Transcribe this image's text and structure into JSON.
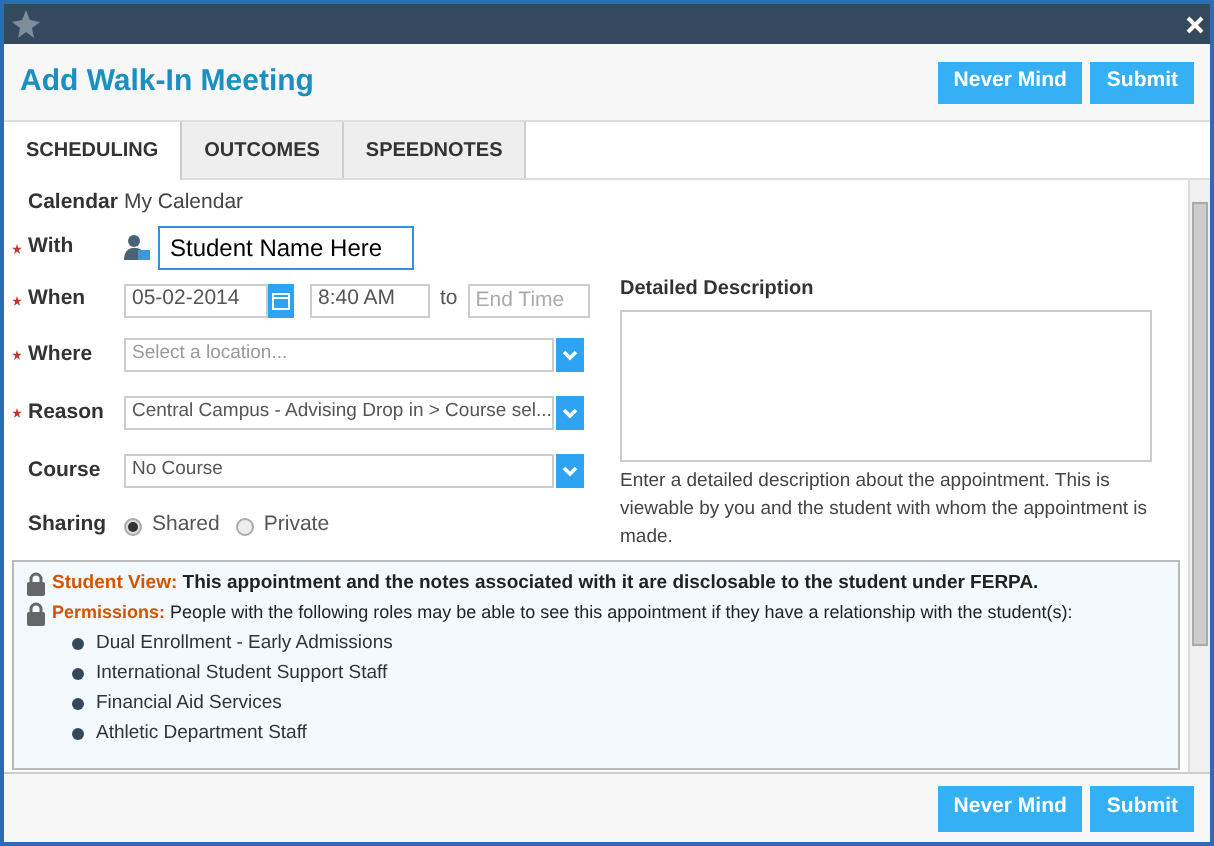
{
  "dialog": {
    "title": "Add Walk-In Meeting"
  },
  "header_buttons": [
    "Never Mind",
    "Submit"
  ],
  "tabs": [
    {
      "label": "SCHEDULING",
      "selected": true
    },
    {
      "label": "OUTCOMES",
      "selected": false
    },
    {
      "label": "SPEEDNOTES",
      "selected": false
    }
  ],
  "form": {
    "calendar": {
      "label": "Calendar",
      "value": "My Calendar"
    },
    "with": {
      "label": "With",
      "required": true,
      "value": "Student Name Here"
    },
    "when": {
      "label": "When",
      "required": true,
      "date": "05-02-2014",
      "start_time": "8:40 AM",
      "separator": "to",
      "end_placeholder": "End Time"
    },
    "selects": [
      {
        "label": "Where",
        "required": true,
        "placeholder": "Select a location..."
      },
      {
        "label": "Reason",
        "required": true,
        "value": "Central Campus - Advising Drop in > Course sel..."
      },
      {
        "label": "Course",
        "required": false,
        "value": "No Course"
      }
    ],
    "sharing": {
      "label": "Sharing",
      "options": [
        {
          "label": "Shared",
          "selected": true
        },
        {
          "label": "Private",
          "selected": false
        }
      ]
    }
  },
  "description": {
    "label": "Detailed Description",
    "help": "Enter a detailed description about the appointment. This is viewable by you and the student with whom the appointment is made."
  },
  "notice": {
    "student_view": {
      "label": "Student View:",
      "text": "This appointment and the notes associated with it are disclosable to the student under FERPA."
    },
    "permissions": {
      "label": "Permissions:",
      "text": "People with the following roles may be able to see this appointment if they have a relationship with the student(s):"
    },
    "roles": [
      "Dual Enrollment - Early Admissions",
      "International Student Support Staff",
      "Financial Aid Services",
      "Athletic Department Staff"
    ]
  },
  "footer_buttons": [
    "Never Mind",
    "Submit"
  ]
}
